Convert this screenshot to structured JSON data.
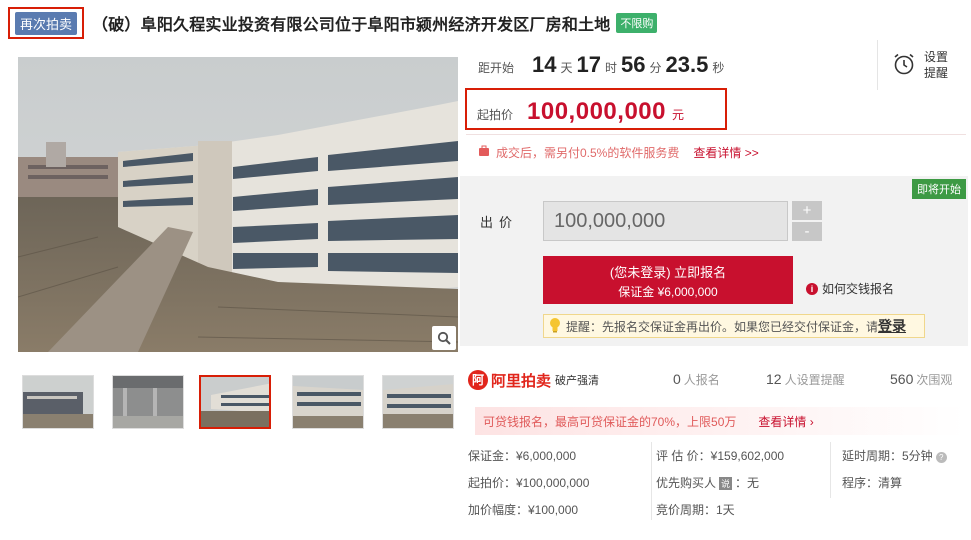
{
  "title": {
    "relist_tag": "再次拍卖",
    "text": "（破）阜阳久程实业投资有限公司位于阜阳市颍州经济开发区厂房和土地",
    "limit_tag": "不限购"
  },
  "countdown": {
    "label": "距开始",
    "days": "14",
    "days_unit": "天",
    "hours": "17",
    "hours_unit": "时",
    "minutes": "56",
    "minutes_unit": "分",
    "seconds": "23.5",
    "seconds_unit": "秒"
  },
  "remind": {
    "label": "设置提醒"
  },
  "start_price": {
    "label": "起拍价",
    "value": "100,000,000",
    "unit": "元"
  },
  "fee_notice": {
    "text": "成交后，需另付0.5%的软件服务费",
    "link": "查看详情 >>"
  },
  "bid": {
    "soon_tag": "即将开始",
    "label": "出价",
    "input_value": "100,000,000",
    "plus": "+",
    "minus": "-",
    "register_line1": "(您未登录) 立即报名",
    "register_line2": "保证金 ¥6,000,000",
    "how_pay": "如何交钱报名",
    "reminder_text": "提醒：先报名交保证金再出价。如果您已经交付保证金，请",
    "reminder_login": "登录"
  },
  "platform": {
    "logo_char": "阿",
    "name": "阿里拍卖",
    "sub": "破产强清"
  },
  "stats": [
    {
      "n": "0",
      "label": "人报名"
    },
    {
      "n": "12",
      "label": "人设置提醒"
    },
    {
      "n": "560",
      "label": "次围观"
    }
  ],
  "deposit_loan": {
    "text": "可贷钱报名，最高可贷保证金的70%，上限50万",
    "link": "查看详情 ›"
  },
  "info": {
    "deposit": "保证金：¥6,000,000",
    "start_price": "起拍价：¥100,000,000",
    "increment": "加价幅度：¥100,000",
    "valuation": "评 估 价：¥159,602,000",
    "priority_buyer_label": "优先购买人",
    "priority_buyer_tag": "说",
    "priority_buyer_value": "：无",
    "bid_period": "竞价周期：1天",
    "delay_period": "延时周期：5分钟",
    "procedure": "程序：清算"
  },
  "colors": {
    "accent": "#c8102e",
    "green": "#3db06b",
    "tag_blue": "#5a7bb0"
  }
}
